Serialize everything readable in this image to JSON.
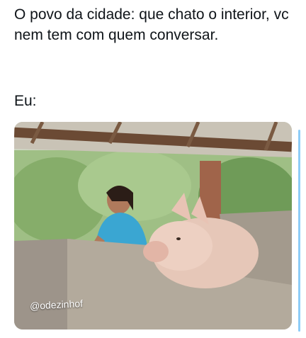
{
  "post": {
    "text": "O povo da cidade: que chato o interior, vc nem tem com quem conversar.",
    "reply_label": "Eu:"
  },
  "image": {
    "watermark": "@odezinhof"
  },
  "colors": {
    "text": "#0f1419",
    "scrollbar": "#8ecdf8"
  }
}
